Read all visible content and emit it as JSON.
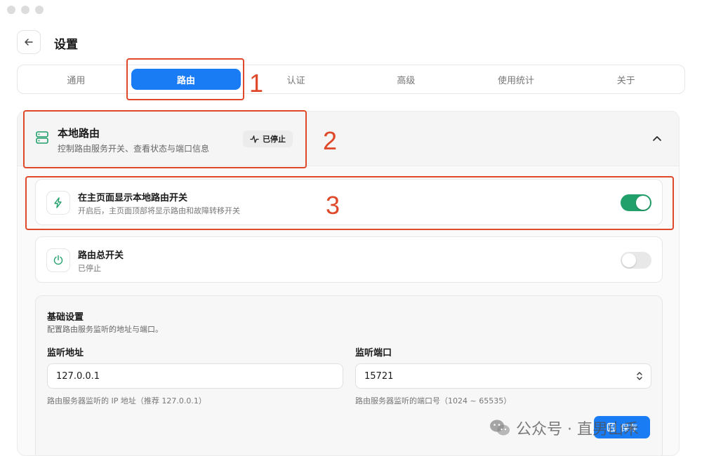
{
  "window": {
    "controls": [
      "close",
      "minimize",
      "zoom"
    ]
  },
  "header": {
    "title": "设置",
    "back_icon": "arrow-left-icon"
  },
  "tabs": [
    {
      "label": "通用",
      "active": false
    },
    {
      "label": "路由",
      "active": true
    },
    {
      "label": "认证",
      "active": false
    },
    {
      "label": "高级",
      "active": false
    },
    {
      "label": "使用统计",
      "active": false
    },
    {
      "label": "关于",
      "active": false
    }
  ],
  "annotations": [
    "1",
    "2",
    "3"
  ],
  "local_route": {
    "title": "本地路由",
    "subtitle": "控制路由服务开关、查看状态与端口信息",
    "status": "已停止",
    "icon": "server-icon"
  },
  "rows": [
    {
      "title": "在主页面显示本地路由开关",
      "subtitle": "开启后，主页面顶部将显示路由和故障转移开关",
      "enabled": true,
      "icon": "lightning-icon"
    },
    {
      "title": "路由总开关",
      "subtitle": "已停止",
      "enabled": false,
      "icon": "power-icon"
    }
  ],
  "basic_settings": {
    "title": "基础设置",
    "subtitle": "配置路由服务监听的地址与端口。",
    "address_label": "监听地址",
    "address_value": "127.0.0.1",
    "address_hint": "路由服务器监听的 IP 地址（推荐 127.0.0.1）",
    "port_label": "监听端口",
    "port_value": "15721",
    "port_hint": "路由服务器监听的端口号（1024 ~ 65535）"
  },
  "save_label": "保存",
  "watermark": "公众号 · 直男山禾",
  "colors": {
    "accent": "#1a7cf5",
    "toggle_on": "#22a06b",
    "annotation": "#e0482a"
  }
}
